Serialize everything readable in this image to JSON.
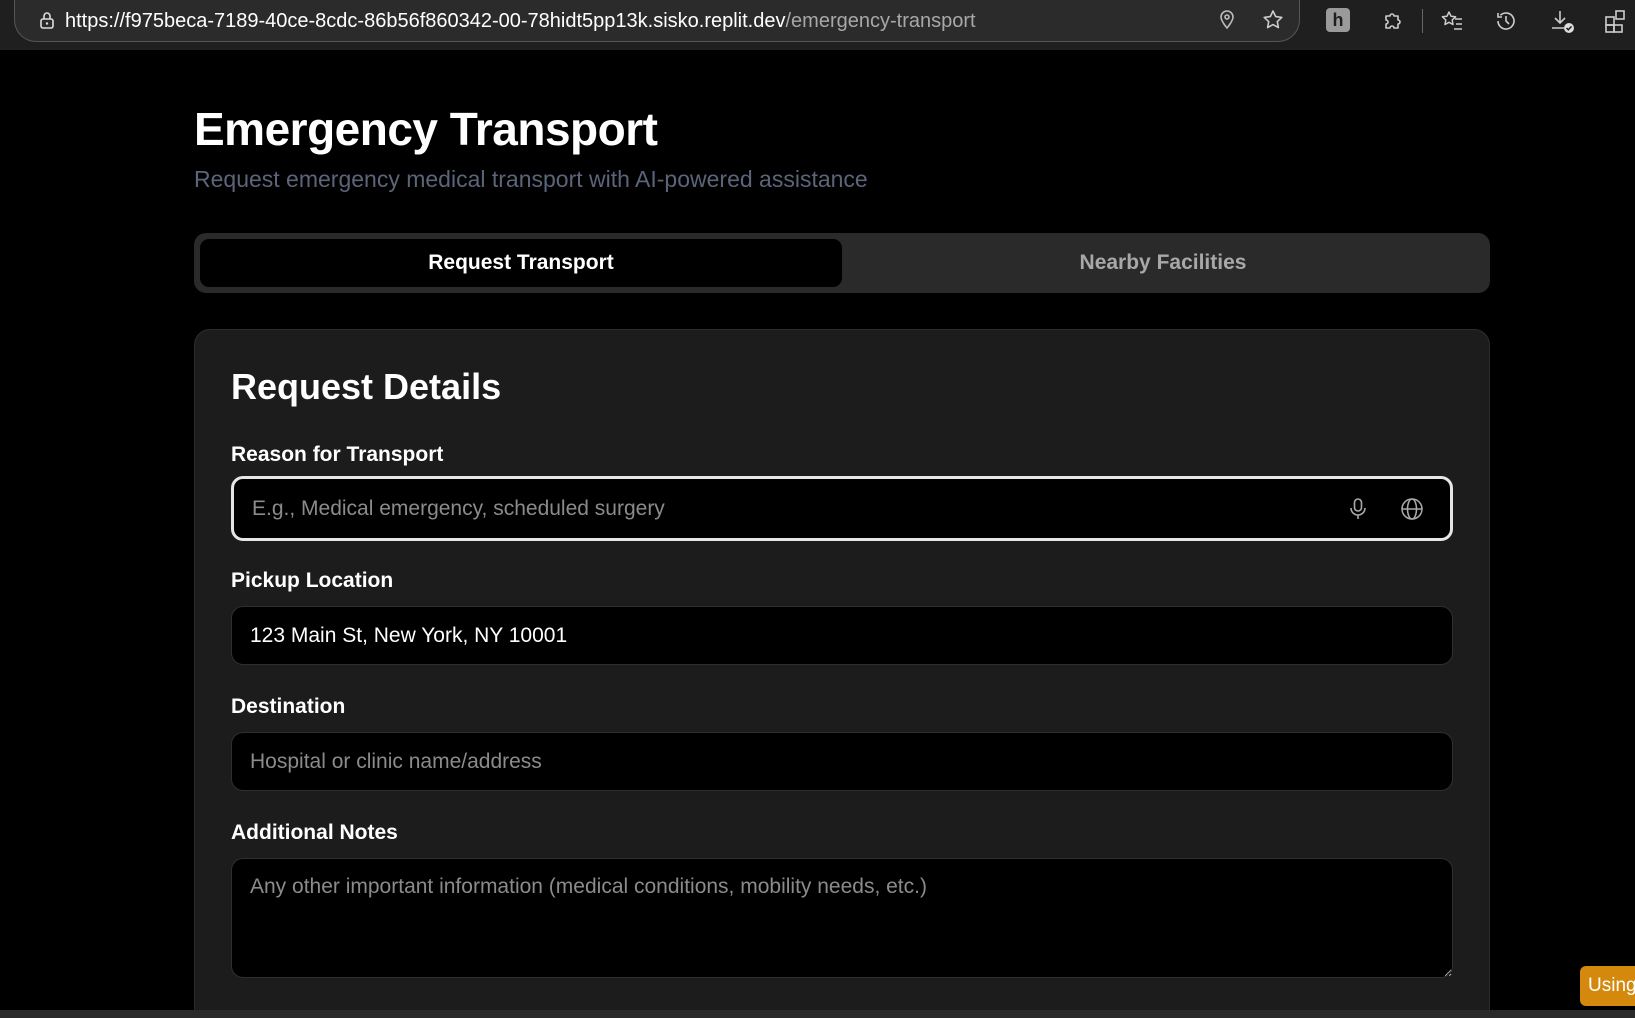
{
  "browser": {
    "url_host": "https://f975beca-7189-40ce-8cdc-86b56f860342-00-78hidt5pp13k.sisko.replit.dev",
    "url_path": "/emergency-transport",
    "extension_badge": "h"
  },
  "page": {
    "title": "Emergency Transport",
    "subtitle": "Request emergency medical transport with AI-powered assistance"
  },
  "tabs": [
    {
      "label": "Request Transport",
      "active": true
    },
    {
      "label": "Nearby Facilities",
      "active": false
    }
  ],
  "form": {
    "title": "Request Details",
    "reason": {
      "label": "Reason for Transport",
      "placeholder": "E.g., Medical emergency, scheduled surgery",
      "value": ""
    },
    "pickup": {
      "label": "Pickup Location",
      "placeholder": "",
      "value": "123 Main St, New York, NY 10001"
    },
    "destination": {
      "label": "Destination",
      "placeholder": "Hospital or clinic name/address",
      "value": ""
    },
    "notes": {
      "label": "Additional Notes",
      "placeholder": "Any other important information (medical conditions, mobility needs, etc.)",
      "value": ""
    }
  },
  "overlay": {
    "badge_text": "Using"
  },
  "colors": {
    "accent": "#d4890d",
    "background": "#000000",
    "card": "#1c1c1c",
    "subtitle": "#5b6478"
  },
  "icons": [
    "lock-icon",
    "location-pin-icon",
    "star-icon",
    "extension-icon",
    "favorites-icon",
    "history-icon",
    "downloads-icon",
    "apps-icon",
    "microphone-icon",
    "globe-icon"
  ]
}
